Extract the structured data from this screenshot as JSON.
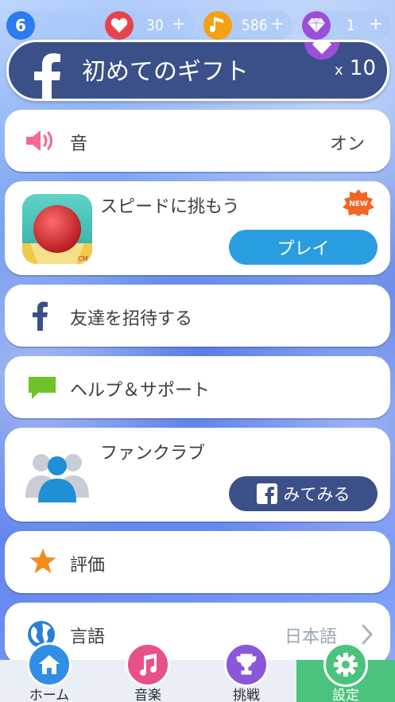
{
  "colors": {
    "accent_blue": "#2a9de0",
    "facebook_navy": "#3b5089",
    "heart_red": "#e8434b",
    "note_orange": "#f4a114",
    "gem_purple": "#9a4fd8",
    "active_tab_green": "#4bc37e"
  },
  "topbar": {
    "level": "6",
    "hearts": {
      "icon": "heart-icon",
      "value": "30",
      "plus": "+"
    },
    "notes": {
      "icon": "music-note-icon",
      "value": "586",
      "plus": "+"
    },
    "gems": {
      "icon": "diamond-icon",
      "value": "1",
      "plus": "+"
    }
  },
  "gift": {
    "icon": "facebook-icon",
    "title": "初めてのギフト",
    "multiplier_prefix": "x",
    "multiplier_value": "10"
  },
  "settings": {
    "sound": {
      "icon": "speaker-icon",
      "label": "音",
      "value": "オン"
    },
    "promo": {
      "icon": "rolling-ball-app-icon",
      "label": "スピードに挑もう",
      "badge": "NEW",
      "button": "プレイ"
    },
    "invite": {
      "icon": "facebook-icon",
      "label": "友達を招待する"
    },
    "help": {
      "icon": "chat-bubble-icon",
      "label": "ヘルプ＆サポート"
    },
    "fanclub": {
      "icon": "group-people-icon",
      "label": "ファンクラブ",
      "button": "みてみる"
    },
    "rate": {
      "icon": "star-icon",
      "label": "評価"
    },
    "language": {
      "icon": "globe-icon",
      "label": "言語",
      "value": "日本語"
    }
  },
  "nav": {
    "tabs": [
      {
        "label": "ホーム",
        "icon": "home-icon"
      },
      {
        "label": "音楽",
        "icon": "music-note-icon"
      },
      {
        "label": "挑戦",
        "icon": "trophy-icon"
      },
      {
        "label": "設定",
        "icon": "gear-icon"
      }
    ],
    "active": "設定"
  }
}
